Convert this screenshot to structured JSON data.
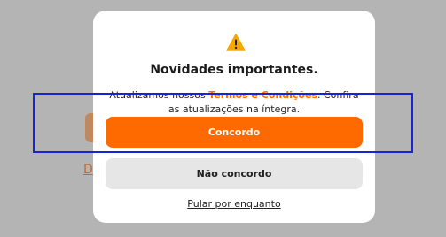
{
  "background": {
    "link_char": "D"
  },
  "modal": {
    "icon": "warning-icon",
    "title": "Novidades importantes.",
    "body_before": "Atualizamos nossos ",
    "body_link": "Termos e Condições",
    "body_after": ". Confira as atualizações na íntegra.",
    "agree_label": "Concordo",
    "disagree_label": "Não concordo",
    "skip_label": "Pular por enquanto"
  },
  "colors": {
    "accent": "#ff6a00",
    "overlay": "#b4b4b4",
    "highlight": "#1a22d8"
  }
}
